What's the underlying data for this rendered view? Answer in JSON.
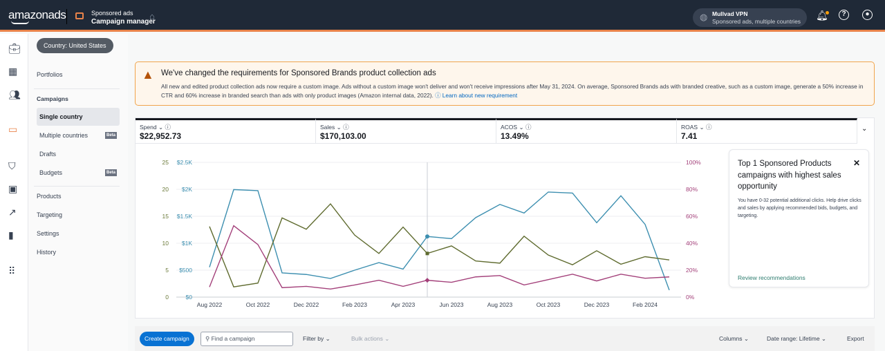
{
  "header": {
    "logo": "amazonads",
    "app_line1": "Sponsored ads",
    "app_line2": "Campaign manager",
    "account_name": "Mullvad VPN",
    "account_sub": "Sponsored ads, multiple countries"
  },
  "country_filter": "Country: United States",
  "sidebar": {
    "portfolios": "Portfolios",
    "campaigns": "Campaigns",
    "sub": [
      {
        "label": "Single country",
        "active": true
      },
      {
        "label": "Multiple countries",
        "badge": "Beta"
      },
      {
        "label": "Drafts"
      },
      {
        "label": "Budgets",
        "badge": "Beta"
      }
    ],
    "items": [
      "Products",
      "Targeting",
      "Settings",
      "History"
    ]
  },
  "alert": {
    "title": "We've changed the requirements for Sponsored Brands product collection ads",
    "body": "All new and edited product collection ads now require a custom image. Ads without a custom image won't deliver and won't receive impressions after May 31, 2024. On average, Sponsored Brands ads with branded creative, such as a custom image, generate a 50% increase in CTR and 60% increase in branded search than ads with only product images (Amazon internal data, 2022).",
    "link": "Learn about new requirement"
  },
  "metrics": [
    {
      "label": "Spend",
      "value": "$22,952.73",
      "color": "#3d8fb0"
    },
    {
      "label": "Sales",
      "value": "$170,103.00",
      "color": "#ffffff"
    },
    {
      "label": "ACOS",
      "value": "13.49%",
      "color": "#a3407a"
    },
    {
      "label": "ROAS",
      "value": "7.41",
      "color": "#5f6b2f"
    }
  ],
  "chart_data": {
    "type": "line",
    "x": [
      "Aug 2022",
      "Sep 2022",
      "Oct 2022",
      "Nov 2022",
      "Dec 2022",
      "Jan 2023",
      "Feb 2023",
      "Mar 2023",
      "Apr 2023",
      "May 2023",
      "Jun 2023",
      "Jul 2023",
      "Aug 2023",
      "Sep 2023",
      "Oct 2023",
      "Nov 2023",
      "Dec 2023",
      "Jan 2024",
      "Feb 2024",
      "Mar 2024"
    ],
    "xtick_labels": [
      "Aug 2022",
      "Oct 2022",
      "Dec 2022",
      "Feb 2023",
      "Apr 2023",
      "Jun 2023",
      "Aug 2023",
      "Oct 2023",
      "Dec 2023",
      "Feb 2024"
    ],
    "y_roas_ticks": [
      "0",
      "5",
      "10",
      "15",
      "20",
      "25"
    ],
    "y_spend_ticks": [
      "$0",
      "$500",
      "$1K",
      "$1.5K",
      "$2K",
      "$2.5K"
    ],
    "y_acos_ticks": [
      "0%",
      "20%",
      "40%",
      "60%",
      "80%",
      "100%"
    ],
    "ylim_roas": [
      0,
      25
    ],
    "ylim_spend": [
      0,
      2500
    ],
    "ylim_acos": [
      0,
      100
    ],
    "highlight": "May 2023",
    "series": [
      {
        "key": "spend",
        "axis": "spend",
        "color": "#3d8fb0",
        "values": [
          555,
          1995,
          1975,
          450,
          420,
          345,
          500,
          640,
          520,
          1125,
          1085,
          1475,
          1720,
          1560,
          1950,
          1930,
          1380,
          1880,
          1350,
          130
        ]
      },
      {
        "key": "roas",
        "axis": "roas",
        "color": "#5f6b2f",
        "values": [
          13.1,
          1.9,
          2.6,
          14.7,
          12.6,
          17.3,
          11.5,
          8.1,
          13.0,
          8.1,
          9.5,
          6.7,
          6.3,
          11.3,
          7.8,
          6.0,
          8.6,
          6.1,
          7.5,
          6.9
        ]
      },
      {
        "key": "acos",
        "axis": "acos",
        "color": "#a3407a",
        "values": [
          7.5,
          53,
          39,
          7,
          8,
          6,
          9,
          12.5,
          8,
          12.5,
          11,
          15,
          16,
          9,
          13,
          17,
          12,
          17,
          14,
          15
        ]
      }
    ]
  },
  "reco": {
    "title": "Top 1 Sponsored Products campaigns with highest sales opportunity",
    "body": "You have 0-32 potential additional clicks. Help drive clicks and sales by applying recommended bids, budgets, and targeting.",
    "link": "Review recommendations"
  },
  "toolbar": {
    "create": "Create campaign",
    "search_placeholder": "Find a campaign",
    "filter": "Filter by",
    "bulk": "Bulk actions",
    "columns": "Columns",
    "date_range": "Date range: Lifetime",
    "export": "Export"
  }
}
